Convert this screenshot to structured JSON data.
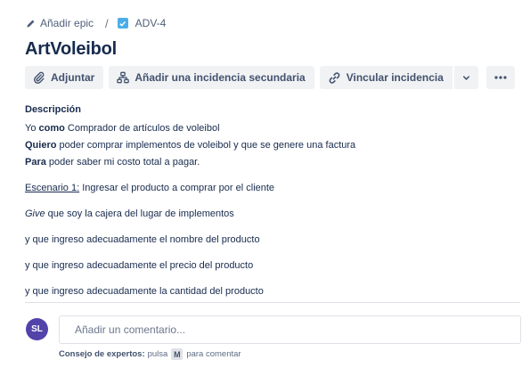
{
  "breadcrumb": {
    "epic_label": "Añadir epic",
    "issue_key": "ADV-4",
    "separator": "/"
  },
  "issue": {
    "title": "ArtVoleibol"
  },
  "toolbar": {
    "attach_label": "Adjuntar",
    "add_child_label": "Añadir una incidencia secundaria",
    "link_label": "Vincular incidencia"
  },
  "description": {
    "label": "Descripción",
    "line1": {
      "bold": "Yo",
      "bold2": "como",
      "rest": " Comprador de artículos de voleibol"
    },
    "line2": {
      "bold": "Quiero",
      "rest": " poder comprar implementos de voleibol y que se genere una factura"
    },
    "line3": {
      "bold": "Para",
      "rest": " poder saber mi costo total a pagar."
    },
    "line4": {
      "underline": "Escenario 1:",
      "rest": " Ingresar el producto a comprar por el cliente"
    },
    "line5": {
      "italic": "Give",
      "rest": " que soy la cajera del lugar de implementos"
    },
    "line6": "y que ingreso adecuadamente el nombre del producto",
    "line7": "y que ingreso adecuadamente el precio del producto",
    "line8": "y que ingreso adecuadamente la cantidad del producto"
  },
  "comment": {
    "avatar_initials": "SL",
    "placeholder": "Añadir un comentario...",
    "tip_bold": "Consejo de expertos:",
    "tip_press": "pulsa",
    "tip_key": "M",
    "tip_end": "para comentar"
  },
  "colors": {
    "avatar": "#5243aa",
    "issue_type": "#4bade8",
    "button_bg": "#f1f2f4"
  }
}
